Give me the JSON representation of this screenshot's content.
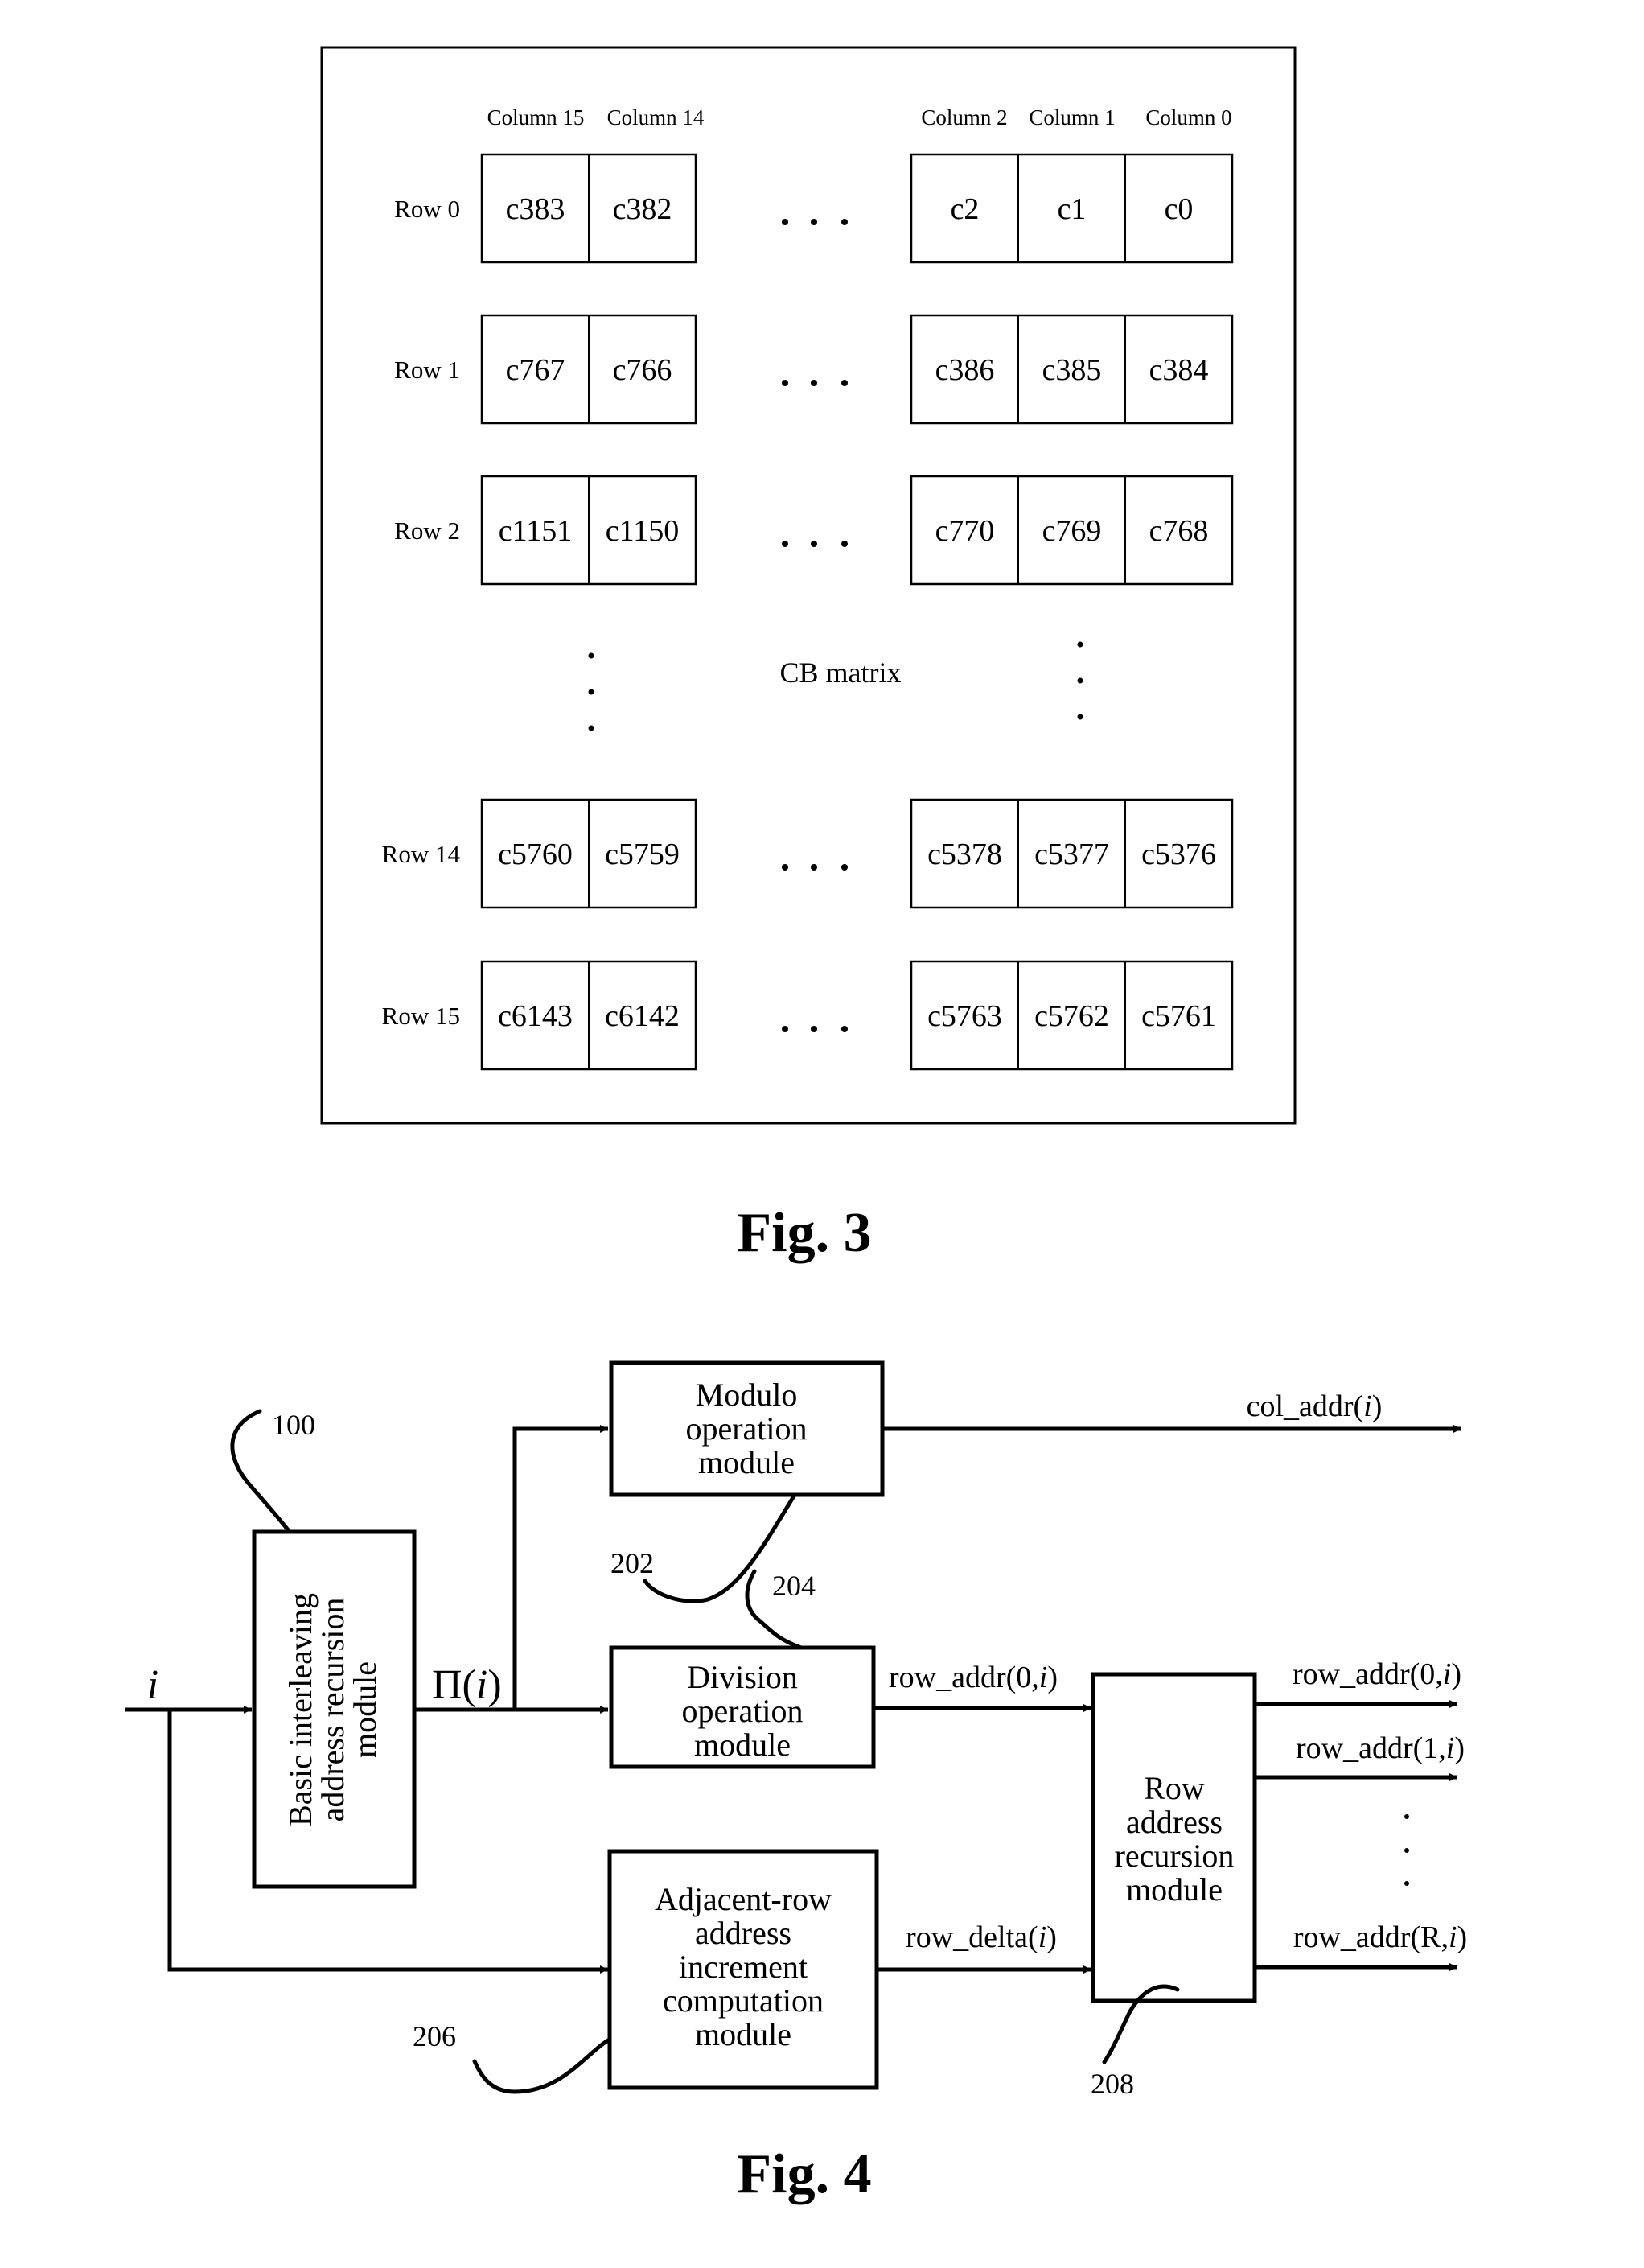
{
  "fig3": {
    "caption": "Fig. 3",
    "matrix_label": "CB matrix",
    "column_headers": {
      "left": [
        "Column 15",
        "Column 14"
      ],
      "right": [
        "Column 2",
        "Column 1",
        "Column 0"
      ]
    },
    "rows": [
      {
        "label": "Row 0",
        "left": [
          "c383",
          "c382"
        ],
        "right": [
          "c2",
          "c1",
          "c0"
        ]
      },
      {
        "label": "Row 1",
        "left": [
          "c767",
          "c766"
        ],
        "right": [
          "c386",
          "c385",
          "c384"
        ]
      },
      {
        "label": "Row 2",
        "left": [
          "c1151",
          "c1150"
        ],
        "right": [
          "c770",
          "c769",
          "c768"
        ]
      },
      {
        "label": "Row 14",
        "left": [
          "c5760",
          "c5759"
        ],
        "right": [
          "c5378",
          "c5377",
          "c5376"
        ]
      },
      {
        "label": "Row 15",
        "left": [
          "c6143",
          "c6142"
        ],
        "right": [
          "c5763",
          "c5762",
          "c5761"
        ]
      }
    ],
    "ellipsis_horizontal": ". . .",
    "ellipsis_vertical": "⋮"
  },
  "fig4": {
    "caption": "Fig. 4",
    "input_signal": "i",
    "pi_signal_main": "Π(",
    "pi_signal_var": "i",
    "pi_signal_close": ")",
    "modules": {
      "basic": {
        "ref": "100",
        "lines": [
          "Basic interleaving",
          "address recursion",
          "module"
        ]
      },
      "modulo": {
        "ref": "202",
        "lines": [
          "Modulo",
          "operation",
          "module"
        ]
      },
      "division": {
        "ref": "204",
        "lines": [
          "Division",
          "operation",
          "module"
        ]
      },
      "adjacent": {
        "ref": "206",
        "lines": [
          "Adjacent-row",
          "address",
          "increment",
          "computation",
          "module"
        ]
      },
      "row_recursion": {
        "ref": "208",
        "lines": [
          "Row",
          "address",
          "recursion",
          "module"
        ]
      }
    },
    "signals": {
      "col_addr": {
        "prefix": "col_addr(",
        "var": "i",
        "suffix": ")"
      },
      "row_addr_in": {
        "prefix": "row_addr(0,",
        "var": "i",
        "suffix": ")"
      },
      "row_delta": {
        "prefix": "row_delta(",
        "var": "i",
        "suffix": ")"
      },
      "outputs": [
        {
          "prefix": "row_addr(0,",
          "var": "i",
          "suffix": ")"
        },
        {
          "prefix": "row_addr(1,",
          "var": "i",
          "suffix": ")"
        },
        {
          "prefix": "row_addr(R,",
          "var": "i",
          "suffix": ")"
        }
      ]
    }
  }
}
